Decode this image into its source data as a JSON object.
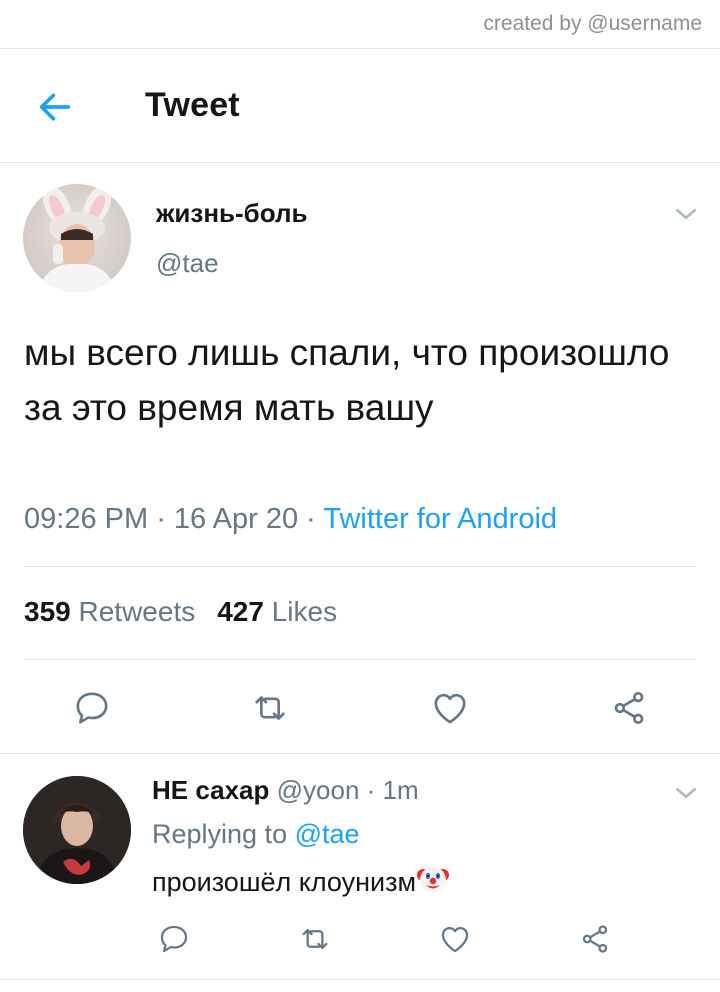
{
  "watermark": "created by @username",
  "header": {
    "title": "Tweet",
    "back_icon": "arrow-left-icon"
  },
  "tweet": {
    "author_name": "жизнь-боль",
    "handle": "@tae",
    "text": "мы всего лишь спали, что произошло за это время мать вашу",
    "time": "09:26 PM",
    "date": "16 Apr 20",
    "source": "Twitter for Android",
    "separator": " · ",
    "retweets_count": "359",
    "retweets_label": "Retweets",
    "likes_count": "427",
    "likes_label": "Likes",
    "actions": [
      "reply-icon",
      "retweet-icon",
      "like-icon",
      "share-icon"
    ]
  },
  "reply": {
    "author_name": "НЕ сахар",
    "handle": "@yoon",
    "separator": " · ",
    "time_ago": "1m",
    "replying_prefix": "Replying to",
    "replying_to": "@tae",
    "text": "произошёл клоунизм",
    "emoji_icon": "clown-face-icon",
    "actions": [
      "reply-icon",
      "retweet-icon",
      "like-icon",
      "share-icon"
    ]
  },
  "colors": {
    "accent": "#1da1f2",
    "text": "#14171a",
    "muted": "#657786",
    "divider": "#e1e8ed"
  }
}
